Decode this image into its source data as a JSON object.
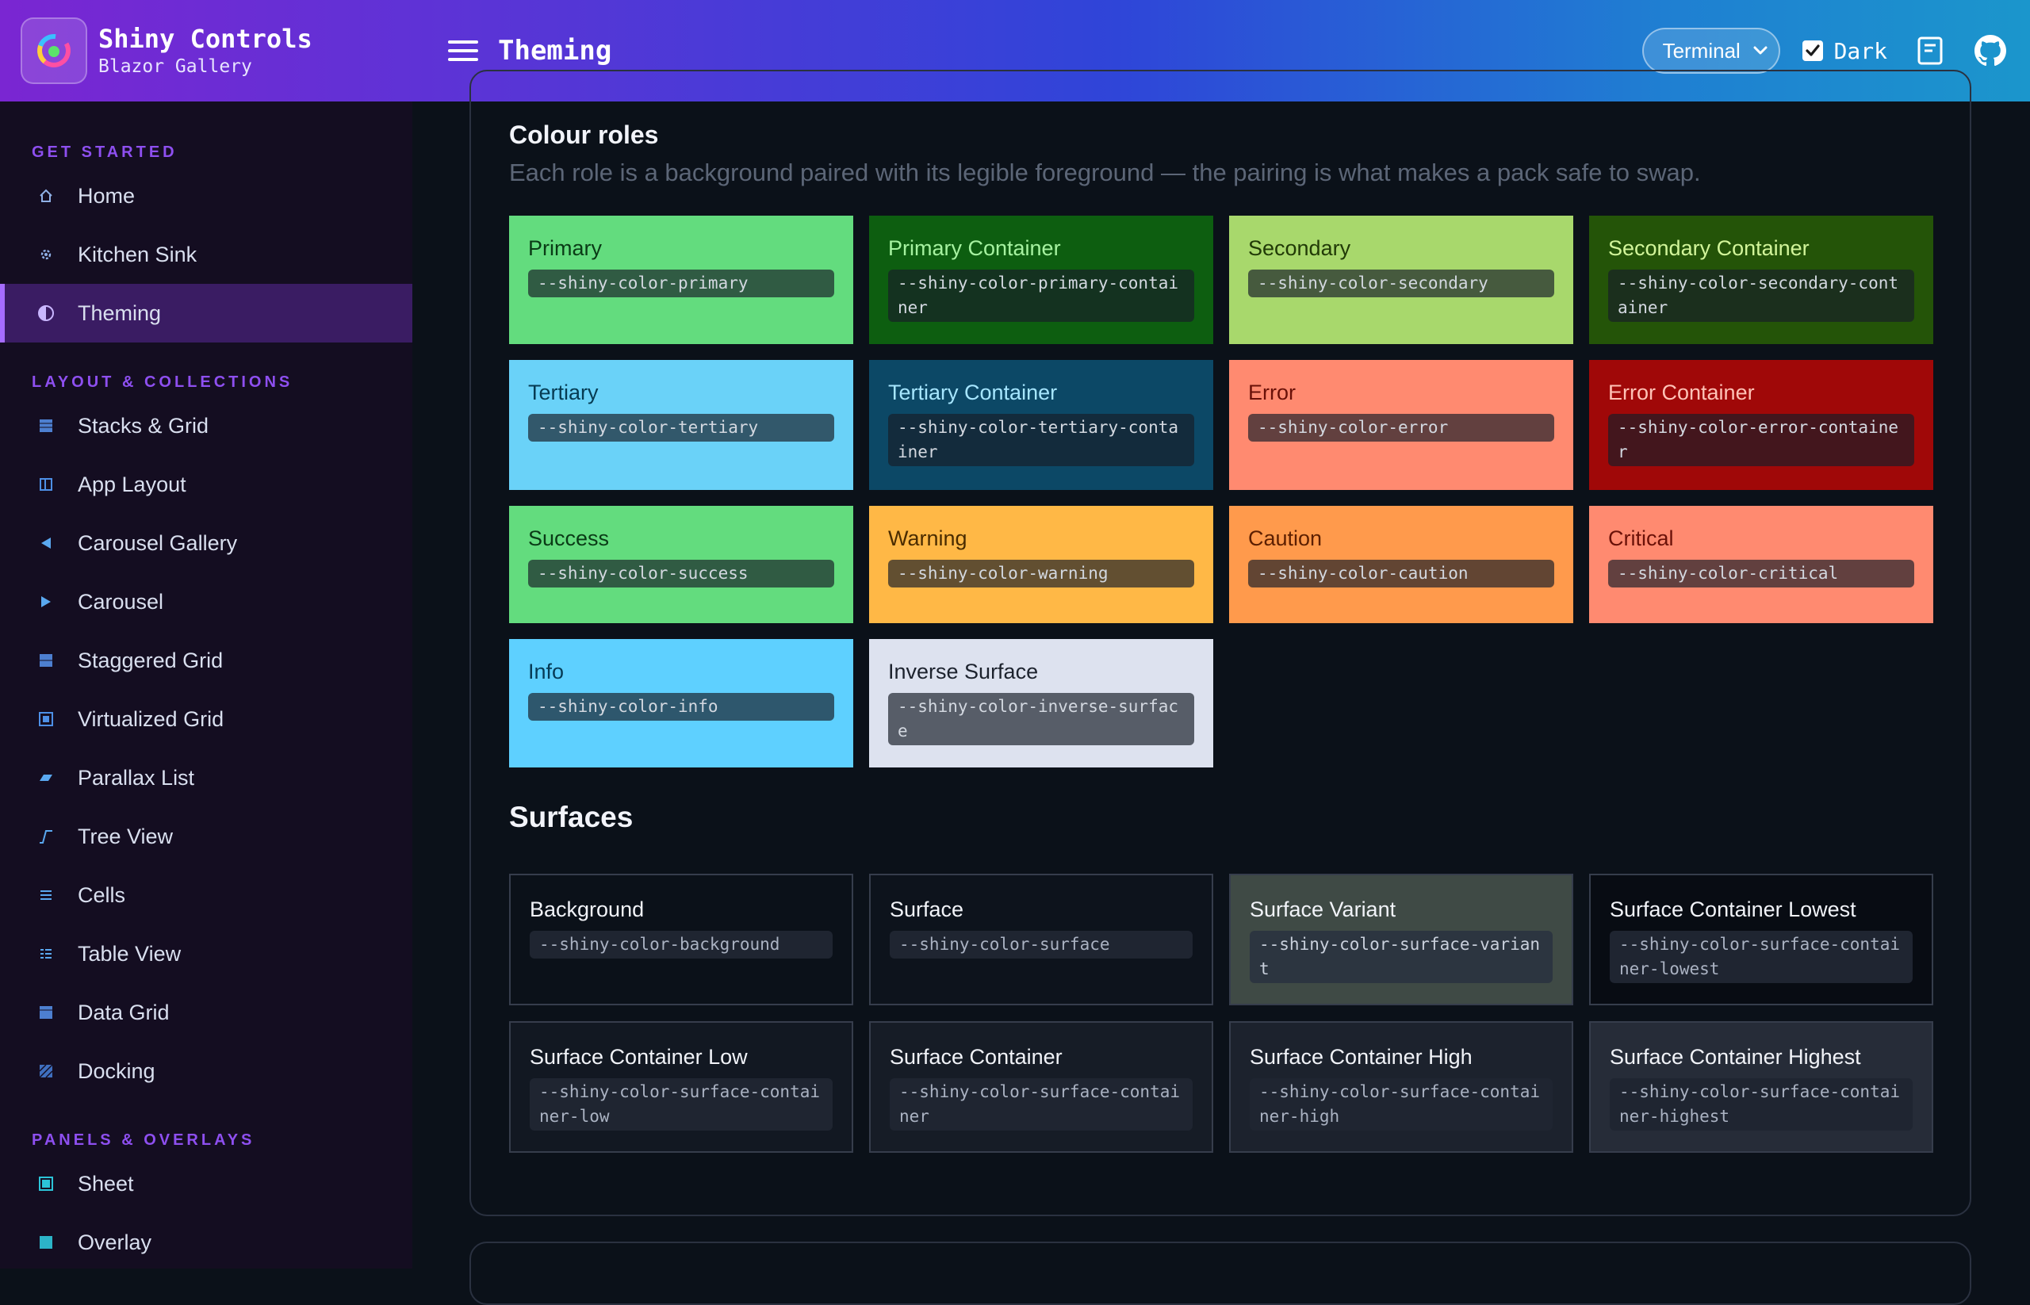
{
  "header": {
    "app_name": "Shiny Controls",
    "app_subtitle": "Blazor Gallery",
    "page_title": "Theming",
    "theme_select_value": "Terminal",
    "dark_label": "Dark",
    "dark_checked": true,
    "colors": {
      "gradient_start": "#7a26d2",
      "gradient_end": "#1b96cc"
    }
  },
  "sidebar": {
    "sections": [
      {
        "title": "GET STARTED",
        "items": [
          {
            "label": "Home",
            "icon": "home-icon"
          },
          {
            "label": "Kitchen Sink",
            "icon": "gear-icon"
          },
          {
            "label": "Theming",
            "icon": "half-circle-icon",
            "active": true
          }
        ]
      },
      {
        "title": "LAYOUT & COLLECTIONS",
        "items": [
          {
            "label": "Stacks & Grid",
            "icon": "grid-icon"
          },
          {
            "label": "App Layout",
            "icon": "layout-icon"
          },
          {
            "label": "Carousel Gallery",
            "icon": "triangle-left-icon"
          },
          {
            "label": "Carousel",
            "icon": "triangle-right-icon"
          },
          {
            "label": "Staggered Grid",
            "icon": "staggered-grid-icon"
          },
          {
            "label": "Virtualized Grid",
            "icon": "virtualized-grid-icon"
          },
          {
            "label": "Parallax List",
            "icon": "parallelogram-icon"
          },
          {
            "label": "Tree View",
            "icon": "tree-icon"
          },
          {
            "label": "Cells",
            "icon": "lines-icon"
          },
          {
            "label": "Table View",
            "icon": "table-icon"
          },
          {
            "label": "Data Grid",
            "icon": "data-grid-icon"
          },
          {
            "label": "Docking",
            "icon": "docking-icon"
          }
        ]
      },
      {
        "title": "PANELS & OVERLAYS",
        "items": [
          {
            "label": "Sheet",
            "icon": "sheet-icon"
          },
          {
            "label": "Overlay",
            "icon": "overlay-icon"
          }
        ]
      }
    ]
  },
  "main": {
    "colour_roles_title": "Colour roles",
    "colour_roles_desc": "Each role is a background paired with its legible foreground — the pairing is what makes a pack safe to swap.",
    "roles": [
      {
        "name": "Primary",
        "var": "--shiny-color-primary",
        "bg": "#63dc7e",
        "fg": "#0a3b16"
      },
      {
        "name": "Primary Container",
        "var": "--shiny-color-primary-container",
        "bg": "#0d5e10",
        "fg": "#a6f2a0"
      },
      {
        "name": "Secondary",
        "var": "--shiny-color-secondary",
        "bg": "#a8d86c",
        "fg": "#213a07"
      },
      {
        "name": "Secondary Container",
        "var": "--shiny-color-secondary-container",
        "bg": "#245408",
        "fg": "#d2f59a"
      },
      {
        "name": "Tertiary",
        "var": "--shiny-color-tertiary",
        "bg": "#6ad2f8",
        "fg": "#063b52"
      },
      {
        "name": "Tertiary Container",
        "var": "--shiny-color-tertiary-container",
        "bg": "#0c4866",
        "fg": "#a6e6ff"
      },
      {
        "name": "Error",
        "var": "--shiny-color-error",
        "bg": "#ff8a70",
        "fg": "#6a1108"
      },
      {
        "name": "Error Container",
        "var": "--shiny-color-error-container",
        "bg": "#a00808",
        "fg": "#ffc2b6"
      },
      {
        "name": "Success",
        "var": "--shiny-color-success",
        "bg": "#63dc7e",
        "fg": "#0a3b16"
      },
      {
        "name": "Warning",
        "var": "--shiny-color-warning",
        "bg": "#ffb846",
        "fg": "#4a2c00"
      },
      {
        "name": "Caution",
        "var": "--shiny-color-caution",
        "bg": "#ff9a4c",
        "fg": "#5c1f00"
      },
      {
        "name": "Critical",
        "var": "--shiny-color-critical",
        "bg": "#ff8a70",
        "fg": "#6a1108"
      },
      {
        "name": "Info",
        "var": "--shiny-color-info",
        "bg": "#5ed0ff",
        "fg": "#063b56"
      },
      {
        "name": "Inverse Surface",
        "var": "--shiny-color-inverse-surface",
        "bg": "#dde2ef",
        "fg": "#1c222d"
      }
    ],
    "surfaces_title": "Surfaces",
    "surfaces": [
      {
        "name": "Background",
        "var": "--shiny-color-background",
        "bg": "#0b1119"
      },
      {
        "name": "Surface",
        "var": "--shiny-color-surface",
        "bg": "#0d131c"
      },
      {
        "name": "Surface Variant",
        "var": "--shiny-color-surface-variant",
        "bg": "#3f4a45"
      },
      {
        "name": "Surface Container Lowest",
        "var": "--shiny-color-surface-container-lowest",
        "bg": "#080c13"
      },
      {
        "name": "Surface Container Low",
        "var": "--shiny-color-surface-container-low",
        "bg": "#121822"
      },
      {
        "name": "Surface Container",
        "var": "--shiny-color-surface-container",
        "bg": "#161c26"
      },
      {
        "name": "Surface Container High",
        "var": "--shiny-color-surface-container-high",
        "bg": "#1c222d"
      },
      {
        "name": "Surface Container Highest",
        "var": "--shiny-color-surface-container-highest",
        "bg": "#262c38"
      }
    ]
  }
}
